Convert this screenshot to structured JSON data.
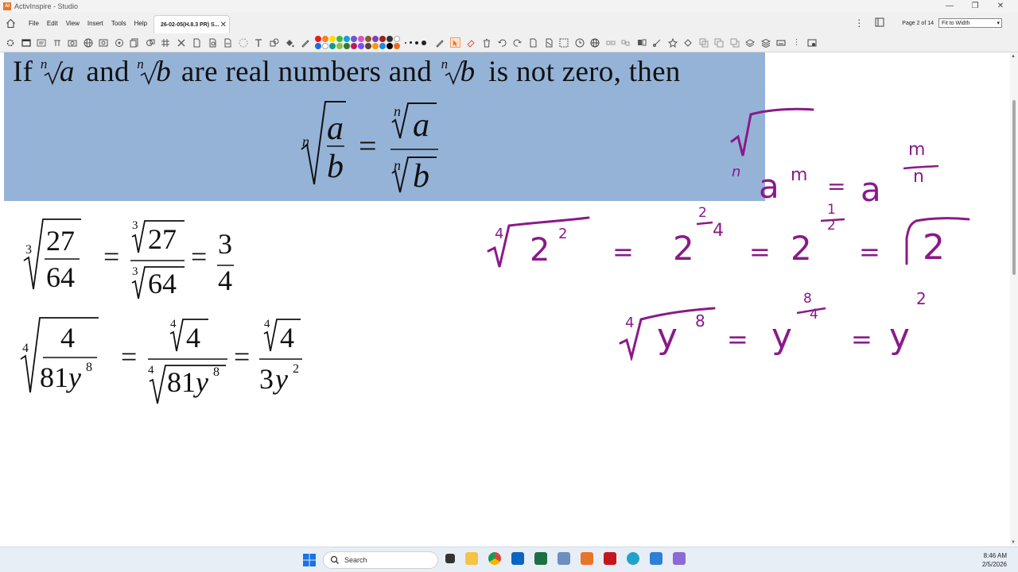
{
  "window": {
    "title": "ActivInspire - Studio",
    "controls": {
      "minimize": "—",
      "restore": "❐",
      "close": "✕"
    }
  },
  "menu": {
    "items": [
      "File",
      "Edit",
      "View",
      "Insert",
      "Tools",
      "Help"
    ],
    "tab_title": "26-02-05(H.8.3 PR) S...",
    "tab_close": "✕",
    "page_info": "Page 2 of 14",
    "zoom": "Fit to Width"
  },
  "palette": {
    "colors": [
      "#e81c1c",
      "#f5821f",
      "#ffde00",
      "#41b93a",
      "#11a1e0",
      "#6a5acd",
      "#e04fcf",
      "#8e5a2a",
      "#7f3fbf",
      "#a01f1f",
      "#333333",
      "#ffffff",
      "#1f6fd6",
      "#ffffff",
      "#0f9b8e",
      "#8bc34a",
      "#2e7d32",
      "#c2185b",
      "#7c4dff",
      "#5d4037",
      "#ff9800",
      "#1e88e5",
      "#000000",
      "#f06b1c"
    ]
  },
  "slide": {
    "rule_text": {
      "if": "If",
      "and1": "and",
      "middle": "are real numbers and",
      "end": "is not zero, then"
    },
    "vars": {
      "n": "n",
      "a": "a",
      "b": "b",
      "m": "m",
      "y": "y"
    },
    "ex1": {
      "index": "3",
      "num": "27",
      "den": "64",
      "ans_num": "3",
      "ans_den": "4"
    },
    "ex2": {
      "index": "4",
      "num": "4",
      "den_coef": "81",
      "den_exp": "8",
      "ans_den_coef": "3",
      "ans_den_exp": "2"
    },
    "equals": "="
  },
  "ink": {
    "line1": {
      "index": "4",
      "base": "2",
      "exp": "2",
      "frac_num": "2",
      "frac_den": "4",
      "half_num": "1",
      "half_den": "2",
      "result": "2"
    },
    "line2": {
      "index": "4",
      "base": "y",
      "exp": "8",
      "frac_num": "8",
      "frac_den": "4",
      "result_exp": "2"
    },
    "color": "#8a1a8a"
  },
  "taskbar": {
    "search_placeholder": "Search",
    "time": "8:46 AM",
    "date": "2/5/2026"
  }
}
